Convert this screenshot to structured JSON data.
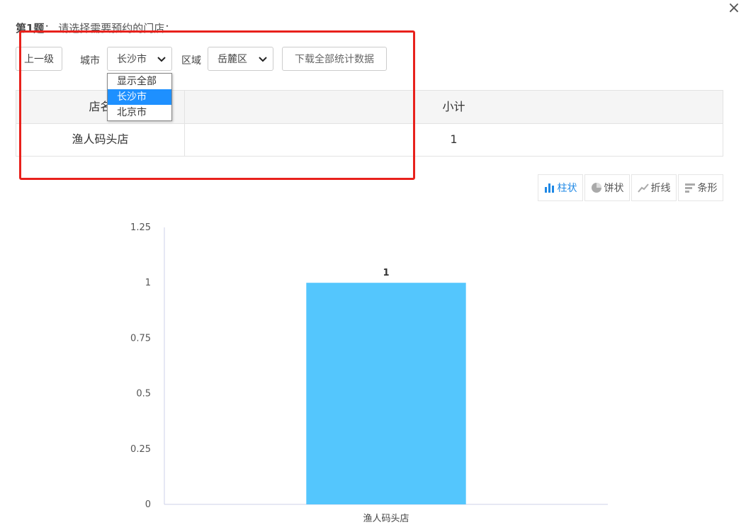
{
  "dialog": {
    "close_label": "×"
  },
  "question": {
    "number": "第1题",
    "text": "：  请选择需要预约的门店："
  },
  "controls": {
    "up_button": "上一级",
    "city_label": "城市",
    "city_value": "长沙市",
    "area_label": "区域",
    "area_value": "岳麓区",
    "download_button": "下载全部统计数据"
  },
  "city_dropdown": {
    "options": [
      "显示全部",
      "长沙市",
      "北京市"
    ],
    "selected_index": 1
  },
  "table": {
    "columns": [
      "店名",
      "小计"
    ],
    "rows": [
      [
        "渔人码头店",
        "1"
      ]
    ]
  },
  "chart_types": {
    "items": [
      {
        "label": "柱状",
        "icon": "bar-chart-icon",
        "active": true
      },
      {
        "label": "饼状",
        "icon": "pie-chart-icon",
        "active": false
      },
      {
        "label": "折线",
        "icon": "line-chart-icon",
        "active": false
      },
      {
        "label": "条形",
        "icon": "hbar-chart-icon",
        "active": false
      }
    ]
  },
  "colors": {
    "bar": "#54c6fd",
    "accent": "#1e88e5",
    "selected": "#1e90ff",
    "highlight_box": "#e8211c"
  },
  "chart_data": {
    "type": "bar",
    "categories": [
      "渔人码头店"
    ],
    "values": [
      1
    ],
    "ylim": [
      0,
      1.25
    ],
    "yticks": [
      "0",
      "0.25",
      "0.5",
      "0.75",
      "1",
      "1.25"
    ],
    "data_labels": [
      "1"
    ],
    "title": "",
    "xlabel": "",
    "ylabel": "",
    "grid": false
  }
}
